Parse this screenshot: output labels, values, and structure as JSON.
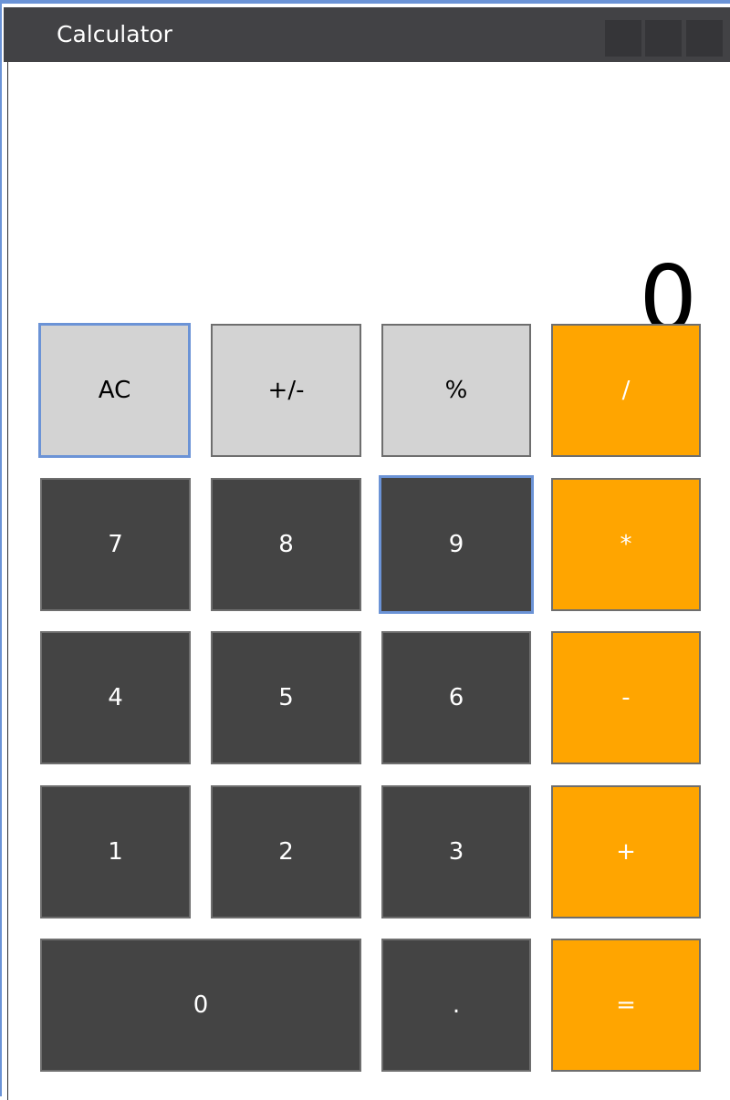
{
  "window": {
    "title": "Calculator"
  },
  "display": {
    "value": "0"
  },
  "keys": {
    "ac": "AC",
    "negate": "+/-",
    "percent": "%",
    "divide": "/",
    "seven": "7",
    "eight": "8",
    "nine": "9",
    "multiply": "*",
    "four": "4",
    "five": "5",
    "six": "6",
    "subtract": "-",
    "one": "1",
    "two": "2",
    "three": "3",
    "add": "+",
    "zero": "0",
    "decimal": ".",
    "equals": "="
  },
  "colors": {
    "function_key": "#d3d3d3",
    "digit_key": "#444444",
    "operator_key": "#ffa500",
    "focus_border": "#6b93d6",
    "titlebar": "#424245"
  }
}
